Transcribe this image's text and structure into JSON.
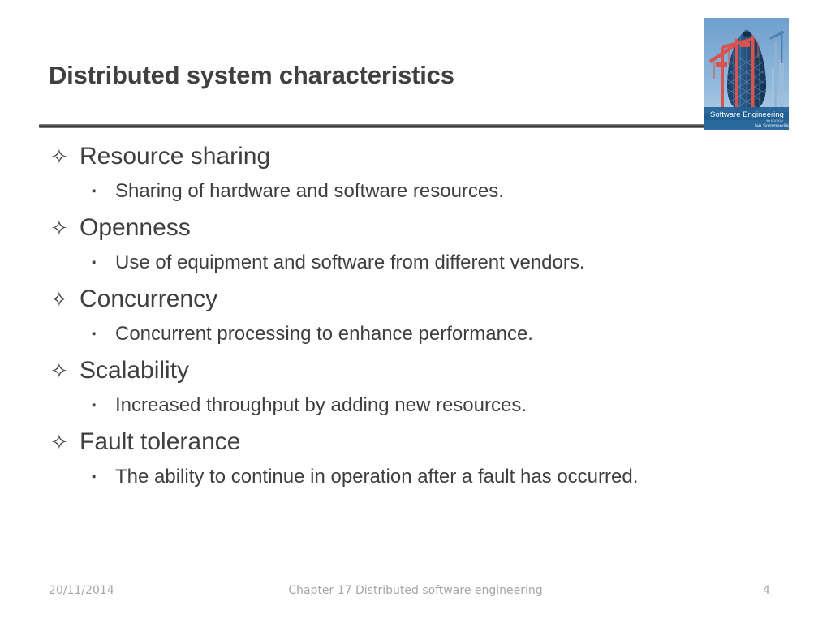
{
  "slide": {
    "title": "Distributed system characteristics",
    "bullet_glyph": "✧",
    "sub_bullet_glyph": "▪",
    "title_color": "#404040",
    "body_color": "#3f3f3f",
    "footer_color": "#a6a6a6",
    "rule_color": "#3d3d3d",
    "background_color": "#ffffff"
  },
  "content": {
    "items": [
      {
        "label": "Resource sharing",
        "sub": "Sharing of hardware and software resources."
      },
      {
        "label": "Openness",
        "sub": "Use of equipment and software from different vendors."
      },
      {
        "label": "Concurrency",
        "sub": "Concurrent processing to enhance performance."
      },
      {
        "label": "Scalability",
        "sub": "Increased throughput by adding new resources."
      },
      {
        "label": "Fault tolerance",
        "sub": "The ability to continue in operation after a fault has occurred."
      }
    ]
  },
  "cover": {
    "book_title": "Software Engineering",
    "author": "Ian Sommerville",
    "edition": "9th EDITION",
    "sky_color": "#7fa8d0",
    "crane_color": "#d9544e",
    "building_color": "#24486e",
    "band_color": "#1f5f96"
  },
  "footer": {
    "date": "20/11/2014",
    "center": "Chapter 17 Distributed software engineering",
    "page": "4"
  }
}
